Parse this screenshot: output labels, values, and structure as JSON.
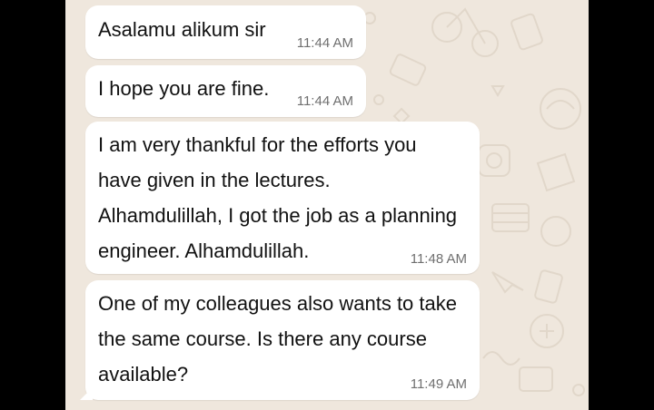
{
  "chat": {
    "messages": [
      {
        "text": "Asalamu alikum sir",
        "time": "11:44 AM"
      },
      {
        "text": "I hope you are fine.",
        "time": "11:44 AM"
      },
      {
        "text": "I am very thankful for the efforts you\nhave given in the lectures.\nAlhamdulillah, I got the job as a planning\nengineer. Alhamdulillah.",
        "time": "11:48 AM"
      },
      {
        "text": "One of my colleagues also wants to take\nthe same course. Is there any course\navailable?",
        "time": "11:49 AM"
      }
    ]
  },
  "colors": {
    "wallpaper": "#efe7dd",
    "bubble": "#ffffff",
    "timestamp": "#6f6f6f"
  }
}
